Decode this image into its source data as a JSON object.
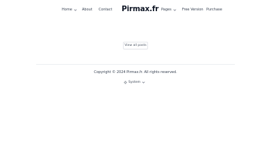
{
  "header": {
    "brand": "Pirmax.fr",
    "nav_left": [
      {
        "label": "Home",
        "has_dropdown": true
      },
      {
        "label": "About",
        "has_dropdown": false
      },
      {
        "label": "Contact",
        "has_dropdown": false
      }
    ],
    "nav_right": [
      {
        "label": "Pages",
        "has_dropdown": true
      },
      {
        "label": "Free Version",
        "has_dropdown": false
      },
      {
        "label": "Purchase",
        "has_dropdown": false
      }
    ]
  },
  "main": {
    "view_all_label": "View all posts"
  },
  "footer": {
    "copyright": "Copyright © 2024 Pirmax.fr. All rights reserved.",
    "theme_label": "System",
    "theme_icon": "sun-icon"
  }
}
